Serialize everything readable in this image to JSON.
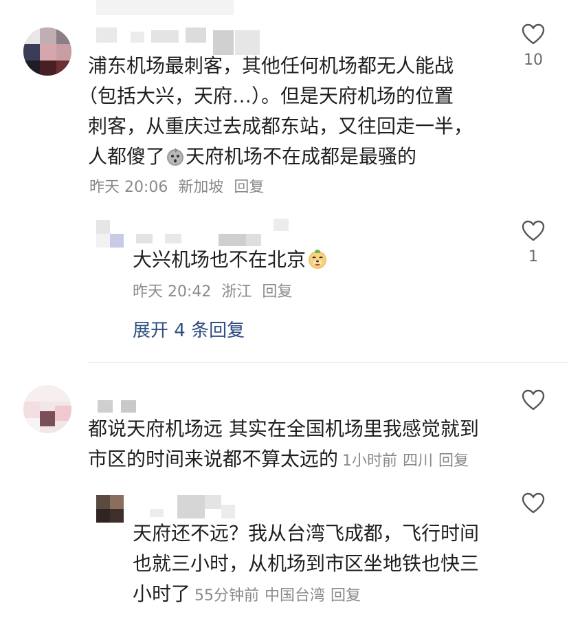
{
  "comments": [
    {
      "text": "浦东机场最刺客，其他任何机场都无人能战（包括大兴，天府…）。但是天府机场的位置刺客，从重庆过去成都东站，又往回走一半，人都傻了",
      "text_line1": "浦东机场最刺客，其他任何机场都无人能战",
      "text_line2": "（包括大兴，天府…）。但是天府机场的位置",
      "text_line3": "刺客，从重庆过去成都东站，又往回走一半，",
      "text_line4_a": "人都傻了",
      "text_line4_b": "天府机场不在成都是最骚的",
      "emoji_icon": "shocked-face-emoji",
      "time": "昨天 20:06",
      "location": "新加坡",
      "reply_label": "回复",
      "likes": "10",
      "replies": [
        {
          "text": "大兴机场也不在北京",
          "emoji_icon": "laughing-dog-emoji",
          "time": "昨天 20:42",
          "location": "浙江",
          "reply_label": "回复",
          "likes": "1"
        }
      ],
      "expand_label": "展开 4 条回复"
    },
    {
      "text_line1": "都说天府机场远 其实在全国机场里我感觉就到",
      "text_line2": "市区的时间来说都不算太远的",
      "time": "1小时前",
      "location": "四川",
      "reply_label": "回复",
      "replies": [
        {
          "text_line1": "天府还不远？我从台湾飞成都，飞行时间",
          "text_line2": "也就三小时，从机场到市区坐地铁也快三",
          "text_line3": "小时了",
          "time": "55分钟前",
          "location": "中国台湾",
          "reply_label": "回复"
        }
      ]
    }
  ],
  "colors": {
    "text": "#1f1f1f",
    "meta": "#8a8a8a",
    "expand_link": "#2f4f80",
    "divider": "#e6e6e6",
    "heart_outline": "#555555"
  }
}
